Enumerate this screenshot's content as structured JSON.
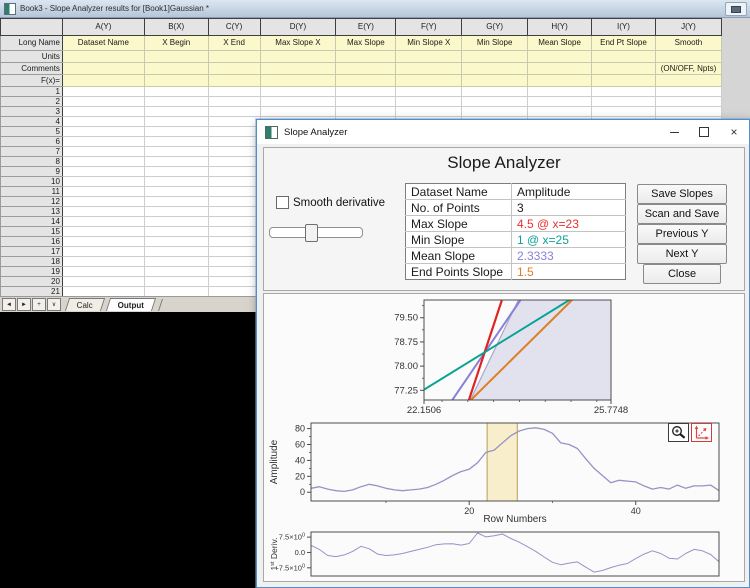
{
  "worksheet": {
    "title": "Book3 - Slope Analyzer results for [Book1]Gaussian *",
    "column_headers": [
      "A(Y)",
      "B(X)",
      "C(Y)",
      "D(Y)",
      "E(Y)",
      "F(Y)",
      "G(Y)",
      "H(Y)",
      "I(Y)",
      "J(Y)"
    ],
    "label_rows": [
      {
        "label": "Long Name",
        "cells": [
          "Dataset Name",
          "X Begin",
          "X End",
          "Max Slope X",
          "Max Slope",
          "Min Slope X",
          "Min Slope",
          "Mean Slope",
          "End Pt Slope",
          "Smooth"
        ]
      },
      {
        "label": "Units",
        "cells": [
          "",
          "",
          "",
          "",
          "",
          "",
          "",
          "",
          "",
          ""
        ]
      },
      {
        "label": "Comments",
        "cells": [
          "",
          "",
          "",
          "",
          "",
          "",
          "",
          "",
          "",
          "(ON/OFF, Npts)"
        ]
      },
      {
        "label": "F(x)=",
        "cells": [
          "",
          "",
          "",
          "",
          "",
          "",
          "",
          "",
          "",
          ""
        ]
      }
    ],
    "num_rows": 22,
    "nav_buttons": [
      {
        "glyph": "◄",
        "name": "scroll-tabs-left"
      },
      {
        "glyph": "►",
        "name": "scroll-tabs-right"
      },
      {
        "glyph": "+",
        "name": "add-sheet"
      },
      {
        "glyph": "∨",
        "name": "sheet-list"
      }
    ],
    "tabs": [
      {
        "label": "Calc",
        "active": false
      },
      {
        "label": "Output",
        "active": true
      }
    ]
  },
  "dialog": {
    "title": "Slope Analyzer",
    "window_buttons": {
      "close": "×"
    },
    "heading": "Slope Analyzer",
    "smooth_checkbox_label": "Smooth derivative",
    "info_table": [
      {
        "label": "Dataset Name",
        "value": "Amplitude",
        "color": "#1a1a1a"
      },
      {
        "label": "No. of Points",
        "value": "3",
        "color": "#1a1a1a"
      },
      {
        "label": "Max Slope",
        "value": "4.5 @ x=23",
        "color": "#e8312d"
      },
      {
        "label": "Min Slope",
        "value": "1 @ x=25",
        "color": "#0fa293"
      },
      {
        "label": "Mean Slope",
        "value": "2.3333",
        "color": "#8781d8"
      },
      {
        "label": "End Points Slope",
        "value": "1.5",
        "color": "#dd7f2b"
      }
    ],
    "buttons": [
      "Save Slopes",
      "Scan and Save",
      "Previous Y",
      "Next Y",
      "Close"
    ]
  },
  "chart_data": [
    {
      "name": "slope-lines-zoom-plot",
      "type": "line",
      "title": "",
      "xlabel": "",
      "ylabel": "",
      "xlim": [
        22.1506,
        25.7748
      ],
      "ylim": [
        76.95,
        80.05
      ],
      "yticks": [
        {
          "value": 79.5,
          "label": "79.50"
        },
        {
          "value": 78.75,
          "label": "78.75"
        },
        {
          "value": 78.0,
          "label": "78.00"
        },
        {
          "value": 77.25,
          "label": "77.25"
        }
      ],
      "yminor": [
        79.875,
        79.125,
        78.375,
        77.625
      ],
      "xtick_labels": [
        {
          "value": 22.1506,
          "label": "22.1506"
        },
        {
          "value": 25.7748,
          "label": "25.7748"
        }
      ],
      "xminor": [
        22.5,
        23.0,
        23.5,
        24.0,
        24.5,
        25.0,
        25.5
      ],
      "region_fill": {
        "fill": "#e1e2ed",
        "edge": "#a9a9ca",
        "points": [
          [
            23.05,
            76.95
          ],
          [
            23.98,
            80.05
          ],
          [
            25.7748,
            80.05
          ],
          [
            25.7748,
            76.95
          ]
        ],
        "edge_line": [
          [
            23.05,
            76.95
          ],
          [
            23.98,
            80.05
          ]
        ]
      },
      "series": [
        {
          "name": "mean-slope-line",
          "color": "#8781d8",
          "width": 2,
          "points": [
            [
              22.7,
              76.95
            ],
            [
              24.02,
              80.05
            ]
          ]
        },
        {
          "name": "max-slope-line",
          "color": "#e02420",
          "width": 2.2,
          "points": [
            [
              23.02,
              76.95
            ],
            [
              23.66,
              80.05
            ]
          ]
        },
        {
          "name": "end-points-slope-line",
          "color": "#de7f28",
          "width": 2,
          "points": [
            [
              23.06,
              76.95
            ],
            [
              25.02,
              80.05
            ]
          ]
        },
        {
          "name": "min-slope-line",
          "color": "#0aa295",
          "width": 2,
          "points": [
            [
              22.1506,
              77.27
            ],
            [
              25.0,
              80.08
            ]
          ]
        }
      ]
    },
    {
      "name": "amplitude-plot",
      "type": "line",
      "xlabel": "Row Numbers",
      "ylabel": "Amplitude",
      "xlim": [
        1,
        50
      ],
      "ylim": [
        -11,
        87
      ],
      "yticks": [
        {
          "value": 0,
          "label": "0"
        },
        {
          "value": 20,
          "label": "20"
        },
        {
          "value": 40,
          "label": "40"
        },
        {
          "value": 60,
          "label": "60"
        },
        {
          "value": 80,
          "label": "80"
        }
      ],
      "yminor": [
        10,
        30,
        50,
        70
      ],
      "xticks": [
        20,
        40
      ],
      "xminor": [
        10,
        30
      ],
      "band": {
        "x1": 22.1506,
        "x2": 25.7748,
        "fill": "#f9eecb",
        "edge": "#b89c58"
      },
      "series": [
        {
          "name": "amplitude-curve",
          "color": "#9693c6",
          "width": 1.3,
          "x_start": 1,
          "x_step": 1,
          "y": [
            5,
            7,
            4,
            2,
            1,
            3,
            7,
            10,
            8,
            5,
            3,
            2,
            3,
            4,
            6,
            10,
            15,
            21,
            26,
            29,
            37,
            50,
            53,
            62,
            71,
            77,
            80,
            81,
            79,
            74,
            62,
            60,
            55,
            42,
            30,
            21,
            12,
            15,
            14,
            13,
            8,
            4,
            6,
            4,
            9,
            5,
            8,
            8,
            9,
            2
          ]
        }
      ]
    },
    {
      "name": "first-derivative-plot",
      "type": "line",
      "xlabel": "",
      "ylabel": {
        "pre": "1",
        "sup": "st",
        "post": " Deriv."
      },
      "xlim": [
        1,
        50
      ],
      "ylim": [
        -11.5,
        10
      ],
      "yticks": [
        {
          "value": 7.5,
          "label": "7.5×10",
          "sup": "0"
        },
        {
          "value": 0,
          "label": "0.0"
        },
        {
          "value": -7.5,
          "label": "-7.5×10",
          "sup": "0"
        }
      ],
      "series": [
        {
          "name": "derivative-curve",
          "color": "#9693c6",
          "width": 1,
          "x_start": 1,
          "x_step": 1,
          "y": [
            3.5,
            1.5,
            -1.5,
            -2,
            -1.2,
            0.5,
            3,
            1.8,
            -0.8,
            -1.5,
            -1.2,
            -0.5,
            0.5,
            1.5,
            2.5,
            3.8,
            4.2,
            4.3,
            3.6,
            4.4,
            9.5,
            7.6,
            8.2,
            9,
            6.8,
            5,
            2.8,
            0.5,
            -2.2,
            -4.8,
            -6,
            -5.2,
            -4.6,
            -7.2,
            -9.6,
            -8.8,
            -7.4,
            -6.2,
            -5.4,
            -3,
            -0.8,
            0.8,
            -0.5,
            -2.8,
            -3.2,
            -0.5,
            1.5,
            0.8,
            -1,
            -4.5
          ]
        }
      ]
    }
  ]
}
